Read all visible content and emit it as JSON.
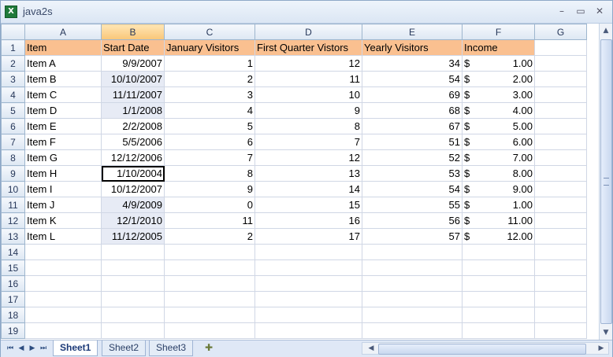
{
  "window": {
    "title": "java2s",
    "icon": "excel-icon"
  },
  "columns": [
    "A",
    "B",
    "C",
    "D",
    "E",
    "F",
    "G"
  ],
  "header_row": {
    "row": "1",
    "cells": [
      "Item",
      "Start Date",
      "January Visitors",
      "First Quarter Vistors",
      "Yearly Visitors",
      "Income"
    ]
  },
  "rows": [
    {
      "row": "2",
      "item": "Item A",
      "date": "9/9/2007",
      "jan": "1",
      "q1": "12",
      "yearly": "34",
      "cur": "$",
      "income": "1.00"
    },
    {
      "row": "3",
      "item": "Item B",
      "date": "10/10/2007",
      "jan": "2",
      "q1": "11",
      "yearly": "54",
      "cur": "$",
      "income": "2.00"
    },
    {
      "row": "4",
      "item": "Item C",
      "date": "11/11/2007",
      "jan": "3",
      "q1": "10",
      "yearly": "69",
      "cur": "$",
      "income": "3.00"
    },
    {
      "row": "5",
      "item": "Item D",
      "date": "1/1/2008",
      "jan": "4",
      "q1": "9",
      "yearly": "68",
      "cur": "$",
      "income": "4.00"
    },
    {
      "row": "6",
      "item": "Item E",
      "date": "2/2/2008",
      "jan": "5",
      "q1": "8",
      "yearly": "67",
      "cur": "$",
      "income": "5.00"
    },
    {
      "row": "7",
      "item": "Item F",
      "date": "5/5/2006",
      "jan": "6",
      "q1": "7",
      "yearly": "51",
      "cur": "$",
      "income": "6.00"
    },
    {
      "row": "8",
      "item": "Item G",
      "date": "12/12/2006",
      "jan": "7",
      "q1": "12",
      "yearly": "52",
      "cur": "$",
      "income": "7.00"
    },
    {
      "row": "9",
      "item": "Item H",
      "date": "1/10/2004",
      "jan": "8",
      "q1": "13",
      "yearly": "53",
      "cur": "$",
      "income": "8.00"
    },
    {
      "row": "10",
      "item": "Item I",
      "date": "10/12/2007",
      "jan": "9",
      "q1": "14",
      "yearly": "54",
      "cur": "$",
      "income": "9.00"
    },
    {
      "row": "11",
      "item": "Item J",
      "date": "4/9/2009",
      "jan": "0",
      "q1": "15",
      "yearly": "55",
      "cur": "$",
      "income": "1.00"
    },
    {
      "row": "12",
      "item": "Item K",
      "date": "12/1/2010",
      "jan": "11",
      "q1": "16",
      "yearly": "56",
      "cur": "$",
      "income": "11.00"
    },
    {
      "row": "13",
      "item": "Item L",
      "date": "11/12/2005",
      "jan": "2",
      "q1": "17",
      "yearly": "57",
      "cur": "$",
      "income": "12.00"
    }
  ],
  "empty_rows": [
    "14",
    "15",
    "16",
    "17",
    "18",
    "19"
  ],
  "sheet_tabs": [
    "Sheet1",
    "Sheet2",
    "Sheet3"
  ],
  "colors": {
    "header_fill": "#fac090",
    "selected_header": "#f9c678",
    "accent": "#1c3a78"
  }
}
